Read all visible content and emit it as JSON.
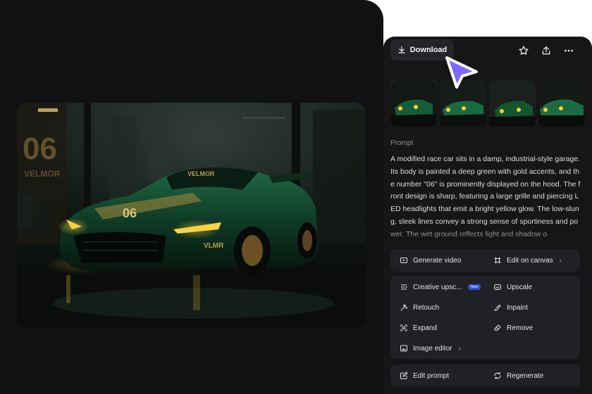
{
  "toolbar": {
    "download_label": "Download",
    "icons": [
      "download-icon",
      "star-icon",
      "share-icon",
      "more-icon"
    ]
  },
  "prompt": {
    "label": "Prompt",
    "text": "A modified race car sits in a damp, industrial-style garage. Its body is painted a deep green with gold accents, and the number \"06\" is prominently displayed on the hood. The front design is sharp, featuring a large grille and piercing LED headlights that emit a bright yellow glow. The low-slung, sleek lines convey a strong sense of sportiness and power. The wet ground reflects light and shadow o"
  },
  "image": {
    "wall_number": "06",
    "wall_brand": "VELMOR",
    "car_number": "06",
    "car_brand_windshield": "VELMOR",
    "car_brand_side": "VLMR"
  },
  "actions": {
    "primary": [
      {
        "label": "Generate video",
        "icon": "video-icon"
      },
      {
        "label": "Edit on canvas",
        "icon": "canvas-icon",
        "chevron": true
      }
    ],
    "tools": [
      {
        "label": "Creative upsc...",
        "icon": "creative-upscale-icon",
        "badge": "New"
      },
      {
        "label": "Upscale",
        "icon": "hd-icon"
      },
      {
        "label": "Retouch",
        "icon": "wand-icon"
      },
      {
        "label": "Inpaint",
        "icon": "inpaint-icon"
      },
      {
        "label": "Expand",
        "icon": "expand-icon"
      },
      {
        "label": "Remove",
        "icon": "eraser-icon"
      },
      {
        "label": "Image editor",
        "icon": "image-editor-icon",
        "chevron": true
      }
    ],
    "bottom": [
      {
        "label": "Edit prompt",
        "icon": "edit-icon"
      },
      {
        "label": "Regenerate",
        "icon": "regenerate-icon"
      }
    ]
  },
  "colors": {
    "page_bg": "#ffffff",
    "left_bg": "#111114",
    "panel_bg": "#161619",
    "card_bg": "#202126",
    "cursor": "#7b68ff",
    "car_green": "#0f3b26",
    "headlight": "#ffcc33"
  }
}
